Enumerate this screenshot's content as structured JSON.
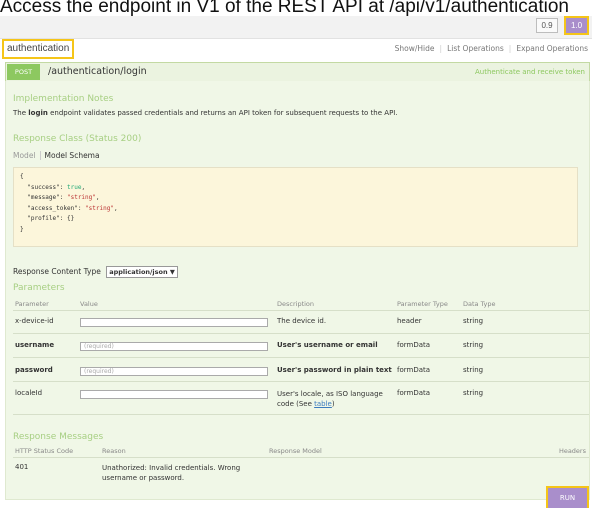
{
  "caption": "Access the endpoint in V1 of the REST API at /api/v1/authentication",
  "versions": [
    "0.9",
    "1.0"
  ],
  "resource": {
    "name": "authentication",
    "links": [
      "Show/Hide",
      "List Operations",
      "Expand Operations"
    ]
  },
  "operation": {
    "method": "POST",
    "path": "/authentication/login",
    "summary": "Authenticate and receive token"
  },
  "notes": {
    "title": "Implementation Notes",
    "prefix": "The ",
    "bold_word": "login",
    "suffix": " endpoint validates passed credentials and returns an API token for subsequent requests to the API."
  },
  "response_class": {
    "title": "Response Class (Status 200)",
    "tab_model": "Model",
    "tab_schema": "Model Schema",
    "schema": {
      "open": "{",
      "l1k": "\"success\"",
      "l1v": "true",
      "l2k": "\"message\"",
      "l2v": "\"string\"",
      "l3k": "\"access_token\"",
      "l3v": "\"string\"",
      "l4k": "\"profile\"",
      "l4v": "{}",
      "close": "}"
    }
  },
  "response_content_type": {
    "label": "Response Content Type",
    "value": "application/json ▼"
  },
  "parameters": {
    "title": "Parameters",
    "headers": [
      "Parameter",
      "Value",
      "Description",
      "Parameter Type",
      "Data Type"
    ],
    "rows": [
      {
        "name": "x-device-id",
        "placeholder": "",
        "description": "The device id.",
        "type": "header",
        "data_type": "string"
      },
      {
        "name": "username",
        "placeholder": "(required)",
        "description": "User's username or email",
        "type": "formData",
        "data_type": "string"
      },
      {
        "name": "password",
        "placeholder": "(required)",
        "description": "User's password in plain text",
        "type": "formData",
        "data_type": "string"
      },
      {
        "name": "localeId",
        "placeholder": "",
        "description_1": "User's locale, as ISO language",
        "description_2": "code (See ",
        "description_link": "table",
        "description_3": ")",
        "type": "formData",
        "data_type": "string"
      }
    ]
  },
  "response_messages": {
    "title": "Response Messages",
    "headers": [
      "HTTP Status Code",
      "Reason",
      "Response Model",
      "Headers"
    ],
    "rows": [
      {
        "code": "401",
        "reason_1": "Unathorized: Invalid credentials. Wrong",
        "reason_2": "username or password."
      }
    ]
  },
  "run_label": "RUN"
}
